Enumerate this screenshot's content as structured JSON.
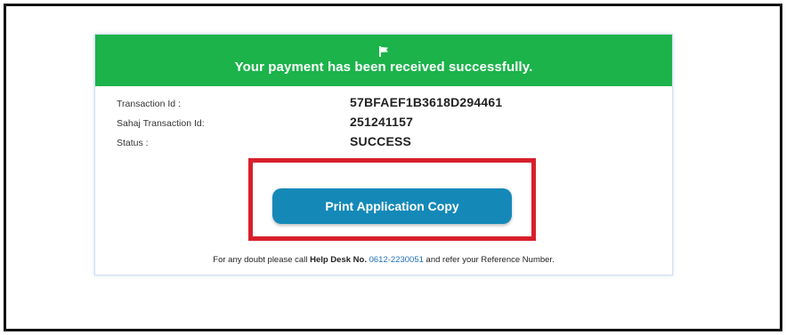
{
  "banner": {
    "icon": "flag-icon",
    "message": "Your payment has been received successfully."
  },
  "details": {
    "rows": [
      {
        "label": "Transaction Id :",
        "value": "57BFAEF1B3618D294461"
      },
      {
        "label": "Sahaj Transaction Id:",
        "value": "251241157"
      },
      {
        "label": "Status :",
        "value": "SUCCESS"
      }
    ]
  },
  "actions": {
    "print_label": "Print Application Copy"
  },
  "footer": {
    "prefix": "For any doubt please call",
    "helpdesk_label": "Help Desk No.",
    "phone": "0612-2230051",
    "suffix": "and refer your Reference Number."
  },
  "colors": {
    "banner_bg": "#1bb34a",
    "button_bg": "#1489b8",
    "highlight_border": "#d8202c",
    "link": "#1f6fb8"
  }
}
